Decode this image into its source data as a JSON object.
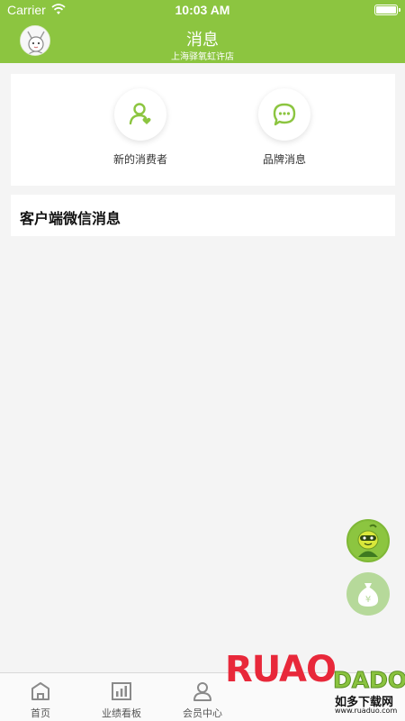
{
  "status_bar": {
    "carrier": "Carrier",
    "time": "10:03 AM"
  },
  "header": {
    "title": "消息",
    "subtitle": "上海驿氧虹许店"
  },
  "entries": [
    {
      "label": "新的消费者",
      "icon": "user-heart-icon"
    },
    {
      "label": "品牌消息",
      "icon": "chat-bubble-icon"
    }
  ],
  "wechat_section": {
    "title": "客户端微信消息"
  },
  "floating_buttons": [
    {
      "icon": "mascot-icon"
    },
    {
      "icon": "money-bag-icon",
      "symbol": "¥"
    }
  ],
  "tabbar": {
    "items": [
      {
        "label": "首页",
        "icon": "home-icon"
      },
      {
        "label": "业绩看板",
        "icon": "chart-icon"
      },
      {
        "label": "会员中心",
        "icon": "member-icon"
      }
    ]
  },
  "watermark": {
    "brand": "RUAODADO",
    "brand_left": "RUAO",
    "brand_right": "DADO",
    "cn": "如多下载网",
    "url": "www.ruaduo.com"
  },
  "colors": {
    "accent": "#8cc540",
    "background": "#f4f4f4",
    "text": "#333333"
  }
}
